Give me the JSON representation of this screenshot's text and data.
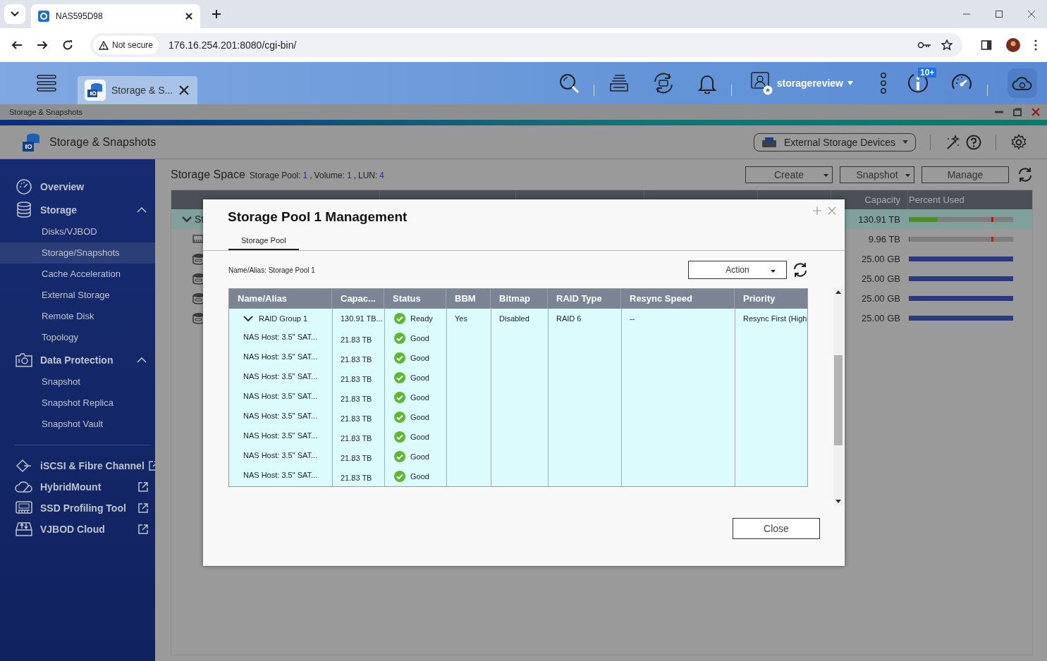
{
  "browser": {
    "tab_title": "NAS595D98",
    "security": "Not secure",
    "url": "176.16.254.201:8080/cgi-bin/"
  },
  "app_bar": {
    "tab": {
      "label": "Storage & S..."
    },
    "user": "storagereview",
    "badge": "10+"
  },
  "window": {
    "title": "Storage & Snapshots"
  },
  "header": {
    "title": "Storage & Snapshots",
    "device_menu": "External Storage Devices"
  },
  "sidebar": {
    "sections": [
      {
        "label": "Overview",
        "kind": "overview"
      },
      {
        "label": "Storage",
        "kind": "storage",
        "expanded": true,
        "children": [
          {
            "label": "Disks/VJBOD",
            "selected": false
          },
          {
            "label": "Storage/Snapshots",
            "selected": true
          },
          {
            "label": "Cache Acceleration",
            "selected": false
          },
          {
            "label": "External Storage",
            "selected": false
          },
          {
            "label": "Remote Disk",
            "selected": false
          },
          {
            "label": "Topology",
            "selected": false
          }
        ]
      },
      {
        "label": "Data Protection",
        "kind": "protection",
        "expanded": true,
        "children": [
          {
            "label": "Snapshot",
            "selected": false
          },
          {
            "label": "Snapshot Replica",
            "selected": false
          },
          {
            "label": "Snapshot Vault",
            "selected": false
          }
        ]
      }
    ],
    "links": [
      {
        "label": "iSCSI & Fibre Channel",
        "kind": "iscsi"
      },
      {
        "label": "HybridMount",
        "kind": "cloud"
      },
      {
        "label": "SSD Profiling Tool",
        "kind": "ssd"
      },
      {
        "label": "VJBOD Cloud",
        "kind": "vjbod"
      }
    ]
  },
  "content": {
    "title": "Storage Space",
    "stats": [
      {
        "label": "Storage Pool:",
        "value": "1",
        "sep": ","
      },
      {
        "label": "Volume:",
        "value": "1",
        "sep": ","
      },
      {
        "label": "LUN:",
        "value": "4"
      }
    ],
    "buttons": [
      {
        "label": "Create",
        "dropdown": true
      },
      {
        "label": "Snapshot",
        "dropdown": true
      },
      {
        "label": "Manage",
        "dropdown": false
      }
    ],
    "table": {
      "columns": [
        "Capacity",
        "Percent Used"
      ],
      "rows": [
        {
          "kind": "pool",
          "name": "St",
          "selected": true,
          "capacity": "130.91 TB",
          "usage": {
            "level": 0.28,
            "color": "#4f8a2e",
            "warning": true
          }
        },
        {
          "kind": "server",
          "selected": false,
          "capacity": "9.96 TB",
          "usage": {
            "level": 0.01,
            "color": "#2a3a7a",
            "warning": true
          }
        },
        {
          "kind": "disk",
          "selected": false,
          "capacity": "25.00 GB",
          "usage": {
            "level": 1,
            "color": "#2a3a7a",
            "warning": false
          }
        },
        {
          "kind": "disk",
          "selected": false,
          "capacity": "25.00 GB",
          "usage": {
            "level": 1,
            "color": "#2a3a7a",
            "warning": false
          }
        },
        {
          "kind": "disk",
          "selected": false,
          "capacity": "25.00 GB",
          "usage": {
            "level": 1,
            "color": "#2a3a7a",
            "warning": false
          }
        },
        {
          "kind": "disk",
          "selected": false,
          "capacity": "25.00 GB",
          "usage": {
            "level": 1,
            "color": "#2a3a7a",
            "warning": false
          }
        }
      ]
    }
  },
  "modal": {
    "title": "Storage Pool 1 Management",
    "tabs": [
      {
        "label": "Storage Pool",
        "selected": true
      }
    ],
    "name_label": "Name/Alias: Storage Pool 1",
    "action": "Action",
    "columns": [
      "Name/Alias",
      "Capac...",
      "Status",
      "BBM",
      "Bitmap",
      "RAID Type",
      "Resync Speed",
      "Priority"
    ],
    "rows": [
      {
        "name": "RAID Group 1",
        "expanded": true,
        "capacity": "130.91 TB...",
        "status": "Ready",
        "bbm": "Yes",
        "bitmap": "Disabled",
        "raid_type": "RAID 6",
        "resync": "--",
        "priority": "Resync First (High",
        "children": [
          {
            "name": "NAS Host: 3.5\" SAT...",
            "capacity": "21.83 TB",
            "status": "Good"
          },
          {
            "name": "NAS Host: 3.5\" SAT...",
            "capacity": "21.83 TB",
            "status": "Good"
          },
          {
            "name": "NAS Host: 3.5\" SAT...",
            "capacity": "21.83 TB",
            "status": "Good"
          },
          {
            "name": "NAS Host: 3.5\" SAT...",
            "capacity": "21.83 TB",
            "status": "Good"
          },
          {
            "name": "NAS Host: 3.5\" SAT...",
            "capacity": "21.83 TB",
            "status": "Good"
          },
          {
            "name": "NAS Host: 3.5\" SAT...",
            "capacity": "21.83 TB",
            "status": "Good"
          },
          {
            "name": "NAS Host: 3.5\" SAT...",
            "capacity": "21.83 TB",
            "status": "Good"
          },
          {
            "name": "NAS Host: 3.5\" SAT...",
            "capacity": "21.83 TB",
            "status": "Good"
          }
        ]
      }
    ],
    "close": "Close"
  }
}
